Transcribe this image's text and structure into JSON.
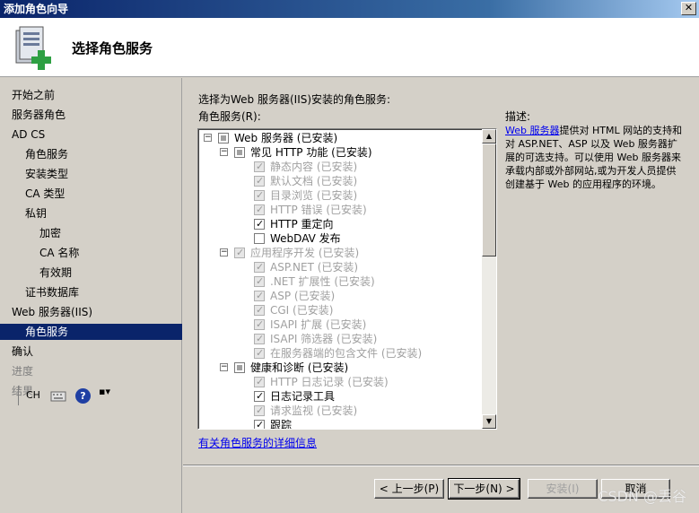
{
  "window": {
    "title": "添加角色向导",
    "close_glyph": "✕"
  },
  "header": {
    "title": "选择角色服务"
  },
  "sidebar": {
    "items": [
      {
        "label": "开始之前",
        "level": 0,
        "state": "normal"
      },
      {
        "label": "服务器角色",
        "level": 0,
        "state": "normal"
      },
      {
        "label": "AD CS",
        "level": 0,
        "state": "normal"
      },
      {
        "label": "角色服务",
        "level": 1,
        "state": "normal"
      },
      {
        "label": "安装类型",
        "level": 1,
        "state": "normal"
      },
      {
        "label": "CA 类型",
        "level": 1,
        "state": "normal"
      },
      {
        "label": "私钥",
        "level": 1,
        "state": "normal"
      },
      {
        "label": "加密",
        "level": 2,
        "state": "normal"
      },
      {
        "label": "CA 名称",
        "level": 2,
        "state": "normal"
      },
      {
        "label": "有效期",
        "level": 2,
        "state": "normal"
      },
      {
        "label": "证书数据库",
        "level": 1,
        "state": "normal"
      },
      {
        "label": "Web 服务器(IIS)",
        "level": 0,
        "state": "normal"
      },
      {
        "label": "角色服务",
        "level": 1,
        "state": "selected"
      },
      {
        "label": "确认",
        "level": 0,
        "state": "normal"
      },
      {
        "label": "进度",
        "level": 0,
        "state": "disabled"
      },
      {
        "label": "结果",
        "level": 0,
        "state": "disabled"
      }
    ]
  },
  "taskbar": {
    "lang": "CH",
    "help": "?",
    "more": "▪▾"
  },
  "main": {
    "instruction": "选择为Web 服务器(IIS)安装的角色服务:",
    "services_label": "角色服务(R):",
    "description_label": "描述:",
    "description_link": "Web 服务器",
    "description_text": "提供对 HTML 网站的支持和对 ASP.NET、ASP 以及 Web 服务器扩展的可选支持。可以使用 Web 服务器来承载内部或外部网站,或为开发人员提供创建基于 Web 的应用程序的环境。",
    "more_info_link": "有关角色服务的详细信息",
    "tree": [
      {
        "label": "Web 服务器  (已安装)",
        "indent": 0,
        "expander": "−",
        "check": "partial",
        "disabled": false
      },
      {
        "label": "常见 HTTP 功能  (已安装)",
        "indent": 1,
        "expander": "−",
        "check": "partial",
        "disabled": false
      },
      {
        "label": "静态内容  (已安装)",
        "indent": 2,
        "expander": "",
        "check": "grey-checked",
        "disabled": true
      },
      {
        "label": "默认文档  (已安装)",
        "indent": 2,
        "expander": "",
        "check": "grey-checked",
        "disabled": true
      },
      {
        "label": "目录浏览  (已安装)",
        "indent": 2,
        "expander": "",
        "check": "grey-checked",
        "disabled": true
      },
      {
        "label": "HTTP 错误  (已安装)",
        "indent": 2,
        "expander": "",
        "check": "grey-checked",
        "disabled": true
      },
      {
        "label": "HTTP 重定向",
        "indent": 2,
        "expander": "",
        "check": "checked",
        "disabled": false
      },
      {
        "label": "WebDAV 发布",
        "indent": 2,
        "expander": "",
        "check": "unchecked",
        "disabled": false
      },
      {
        "label": "应用程序开发  (已安装)",
        "indent": 1,
        "expander": "−",
        "check": "grey-checked",
        "disabled": true
      },
      {
        "label": "ASP.NET  (已安装)",
        "indent": 2,
        "expander": "",
        "check": "grey-checked",
        "disabled": true
      },
      {
        "label": ".NET 扩展性  (已安装)",
        "indent": 2,
        "expander": "",
        "check": "grey-checked",
        "disabled": true
      },
      {
        "label": "ASP  (已安装)",
        "indent": 2,
        "expander": "",
        "check": "grey-checked",
        "disabled": true
      },
      {
        "label": "CGI  (已安装)",
        "indent": 2,
        "expander": "",
        "check": "grey-checked",
        "disabled": true
      },
      {
        "label": "ISAPI 扩展  (已安装)",
        "indent": 2,
        "expander": "",
        "check": "grey-checked",
        "disabled": true
      },
      {
        "label": "ISAPI 筛选器  (已安装)",
        "indent": 2,
        "expander": "",
        "check": "grey-checked",
        "disabled": true
      },
      {
        "label": "在服务器端的包含文件  (已安装)",
        "indent": 2,
        "expander": "",
        "check": "grey-checked",
        "disabled": true
      },
      {
        "label": "健康和诊断  (已安装)",
        "indent": 1,
        "expander": "−",
        "check": "partial",
        "disabled": false
      },
      {
        "label": "HTTP 日志记录  (已安装)",
        "indent": 2,
        "expander": "",
        "check": "grey-checked",
        "disabled": true
      },
      {
        "label": "日志记录工具",
        "indent": 2,
        "expander": "",
        "check": "checked",
        "disabled": false
      },
      {
        "label": "请求监视  (已安装)",
        "indent": 2,
        "expander": "",
        "check": "grey-checked",
        "disabled": true
      },
      {
        "label": "跟踪",
        "indent": 2,
        "expander": "",
        "check": "checked",
        "disabled": false
      }
    ]
  },
  "footer": {
    "prev": "< 上一步(P)",
    "next": "下一步(N) >",
    "install": "安装(I)",
    "cancel": "取消"
  },
  "watermark": "CSDN @丢谷",
  "colors": {
    "selection": "#0a246a",
    "link": "#0000ee",
    "chrome": "#d4d0c8"
  }
}
